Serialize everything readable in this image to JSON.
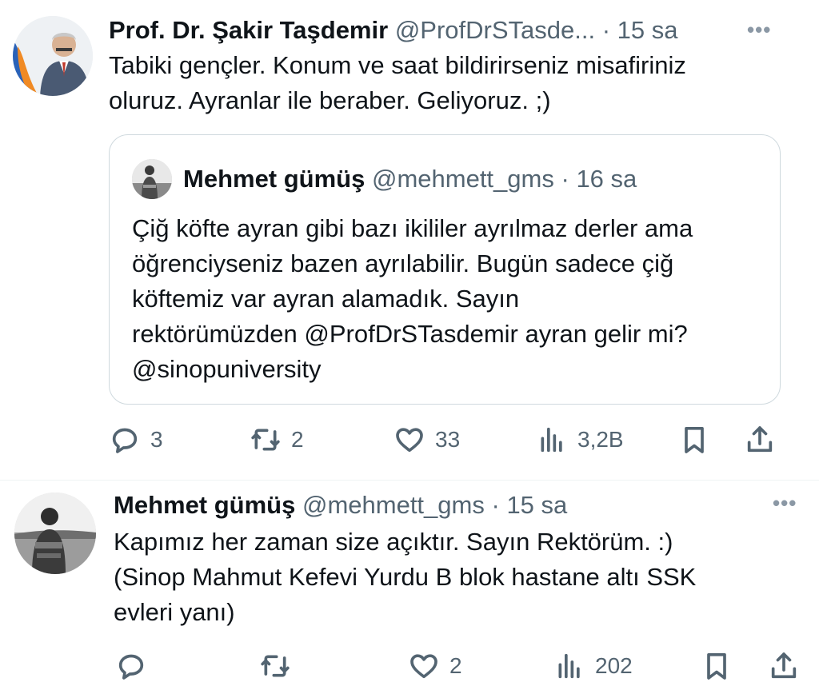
{
  "tweet1": {
    "author_name": "Prof. Dr. Şakir Taşdemir",
    "handle": "@ProfDrSTasde...",
    "separator": "·",
    "time": "15 sa",
    "more": "•••",
    "text": "Tabiki gençler. Konum ve saat bildirirseniz misafiriniz\noluruz.  Ayranlar ile beraber. Geliyoruz. ;)",
    "quote": {
      "author_name": "Mehmet gümüş",
      "handle": "@mehmett_gms",
      "separator": "·",
      "time": "16 sa",
      "text": "Çiğ köfte ayran gibi bazı ikililer ayrılmaz derler ama\nöğrenciyseniz bazen ayrılabilir. Bugün sadece çiğ\nköftemiz var ayran alamadık. Sayın\nrektörümüzden @ProfDrSTasdemir ayran gelir mi?\n@sinopuniversity"
    },
    "actions": {
      "replies": "3",
      "retweets": "2",
      "likes": "33",
      "views": "3,2B"
    }
  },
  "tweet2": {
    "author_name": "Mehmet gümüş",
    "handle": "@mehmett_gms",
    "separator": "·",
    "time": "15 sa",
    "more": "•••",
    "text": "Kapımız her zaman size açıktır. Sayın Rektörüm. :)\n(Sinop Mahmut Kefevi Yurdu B blok hastane altı SSK\nevleri yanı)",
    "actions": {
      "replies": "",
      "retweets": "",
      "likes": "2",
      "views": "202"
    }
  },
  "icons": {
    "reply": "reply-icon",
    "retweet": "retweet-icon",
    "like": "like-icon",
    "views": "views-icon",
    "bookmark": "bookmark-icon",
    "share": "share-icon"
  },
  "colors": {
    "text": "#0f1419",
    "muted": "#536471",
    "border": "#cfd9de"
  }
}
